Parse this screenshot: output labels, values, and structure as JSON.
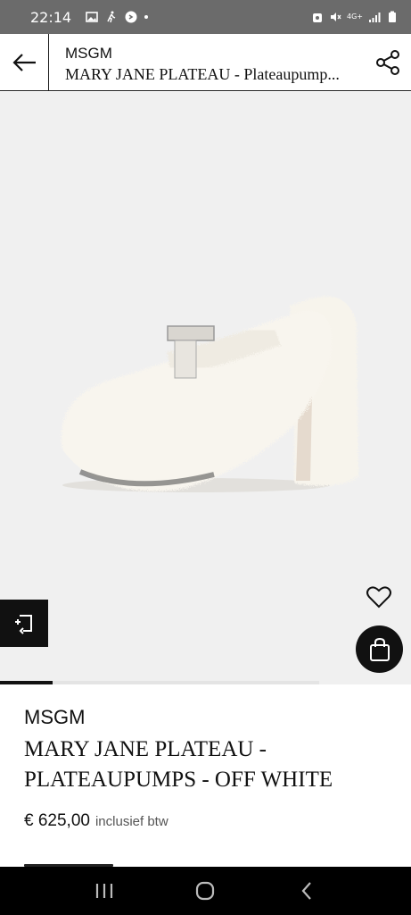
{
  "status_bar": {
    "time": "22:14",
    "network": "4G+",
    "left_icons": [
      "image-icon",
      "walking-icon",
      "shazam-icon",
      "dot-icon"
    ],
    "right_icons": [
      "alarm-icon",
      "mute-icon",
      "data-icon",
      "signal-icon",
      "battery-icon"
    ]
  },
  "header": {
    "brand": "MSGM",
    "product_title": "MARY JANE PLATEAU - Plateaupump..."
  },
  "product": {
    "brand": "MSGM",
    "name": "MARY JANE PLATEAU - PLATEAUPUMPS - OFF WHITE",
    "price": "€ 625,00",
    "price_note": "inclusief btw",
    "image_progress": 0.165
  },
  "colors": {
    "status_bar_bg": "#6b6b6b",
    "image_bg": "#f0f0f0",
    "accent": "#111111",
    "nav_bg": "#000000"
  },
  "nav": {
    "icons": [
      "recent-apps-icon",
      "home-icon",
      "back-nav-icon"
    ]
  }
}
